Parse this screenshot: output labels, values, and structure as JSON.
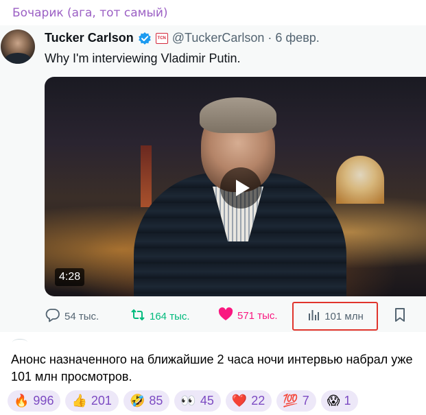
{
  "chat": {
    "sender_name": "Бочарик (ага, тот самый)"
  },
  "tweet": {
    "author_name": "Tucker Carlson",
    "handle": "@TuckerCarlson",
    "separator": "·",
    "date": "6 февр.",
    "text": "Why I'm interviewing Vladimir Putin.",
    "video_duration": "4:28",
    "badge_label": "TCN",
    "actions": {
      "replies": "54 тыс.",
      "retweets": "164 тыс.",
      "likes": "571 тыс.",
      "views": "101 млн"
    }
  },
  "message": {
    "text": "Анонс назначенного на ближайшие 2 часа ночи интервью набрал уже 101 млн просмотров."
  },
  "reactions": [
    {
      "emoji": "🔥",
      "count": "996"
    },
    {
      "emoji": "👍",
      "count": "201"
    },
    {
      "emoji": "🤣",
      "count": "85"
    },
    {
      "emoji": "👀",
      "count": "45"
    },
    {
      "emoji": "❤️",
      "count": "22"
    },
    {
      "emoji": "💯",
      "count": "7"
    },
    {
      "emoji": "😱",
      "count": "1"
    }
  ],
  "colors": {
    "sender": "#9b5fc4",
    "retweet": "#00ba7c",
    "like": "#f91880",
    "highlight_box": "#e0342c",
    "reaction_bg": "#ede8f8",
    "reaction_count": "#7c4ac2"
  }
}
